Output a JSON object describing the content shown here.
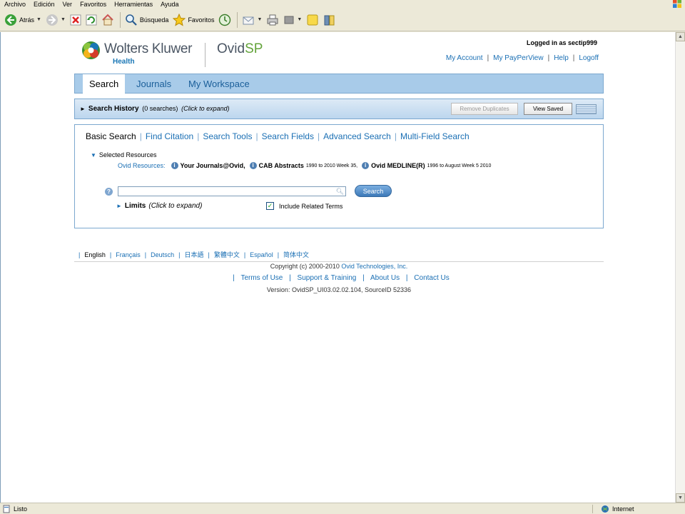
{
  "browser": {
    "menu": [
      "Archivo",
      "Edición",
      "Ver",
      "Favoritos",
      "Herramientas",
      "Ayuda"
    ],
    "toolbar": {
      "back_label": "Atrás",
      "search_label": "Búsqueda",
      "favorites_label": "Favoritos"
    },
    "status": {
      "left_text": "Listo",
      "zone_text": "Internet"
    }
  },
  "header": {
    "brand": "Wolters Kluwer",
    "brand_sub": "Health",
    "product_prefix": "Ovid",
    "product_suffix": "SP",
    "logged_in": "Logged in as sectip999",
    "links": [
      "My Account",
      "My PayPerView",
      "Help",
      "Logoff"
    ]
  },
  "nav": {
    "tabs": [
      "Search",
      "Journals",
      "My Workspace"
    ]
  },
  "history": {
    "title": "Search History",
    "count": "(0 searches)",
    "hint": "(Click to expand)",
    "remove_duplicates_label": "Remove Duplicates",
    "view_saved_label": "View Saved"
  },
  "search": {
    "tabs": [
      "Basic Search",
      "Find Citation",
      "Search Tools",
      "Search Fields",
      "Advanced Search",
      "Multi-Field Search"
    ],
    "selected_resources_label": "Selected Resources",
    "resources_label": "Ovid Resources:",
    "resources": [
      {
        "name": "Your Journals@Ovid,",
        "range": ""
      },
      {
        "name": "CAB Abstracts",
        "range": "1990 to 2010 Week 35,"
      },
      {
        "name": "Ovid MEDLINE(R)",
        "range": "1996 to August Week 5 2010"
      }
    ],
    "query": "",
    "search_button": "Search",
    "limits_label": "Limits",
    "limits_hint": "(Click to expand)",
    "include_related_label": "Include Related Terms",
    "include_related_checked": true
  },
  "languages": [
    "English",
    "Français",
    "Deutsch",
    "日本語",
    "繁體中文",
    "Español",
    "简体中文"
  ],
  "footer": {
    "copyright_prefix": "Copyright (c) 2000-2010",
    "copyright_link": "Ovid Technologies, Inc.",
    "links": [
      "Terms of Use",
      "Support & Training",
      "About Us",
      "Contact Us"
    ],
    "version": "Version: OvidSP_UI03.02.02.104, SourceID 52336"
  }
}
